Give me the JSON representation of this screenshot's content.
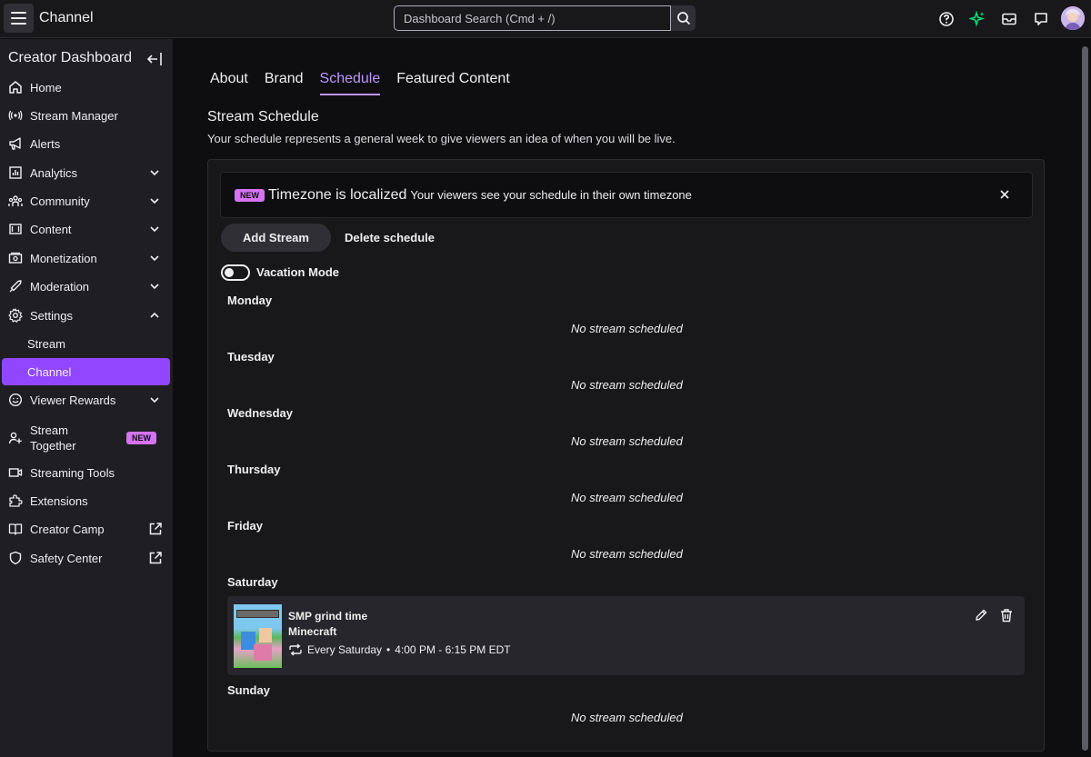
{
  "topbar": {
    "title": "Channel",
    "search_placeholder": "Dashboard Search (Cmd + /)"
  },
  "sidebar": {
    "title": "Creator Dashboard",
    "items": [
      {
        "label": "Home",
        "icon": "home-icon"
      },
      {
        "label": "Stream Manager",
        "icon": "broadcast-icon"
      },
      {
        "label": "Alerts",
        "icon": "megaphone-icon"
      },
      {
        "label": "Analytics",
        "icon": "analytics-icon"
      },
      {
        "label": "Community",
        "icon": "community-icon"
      },
      {
        "label": "Content",
        "icon": "content-icon"
      },
      {
        "label": "Monetization",
        "icon": "money-icon"
      },
      {
        "label": "Moderation",
        "icon": "sword-icon"
      },
      {
        "label": "Settings",
        "icon": "gear-icon"
      },
      {
        "label": "Stream"
      },
      {
        "label": "Channel"
      },
      {
        "label": "Viewer Rewards",
        "icon": "rewards-icon"
      },
      {
        "label": "Stream Together",
        "icon": "add-person-icon",
        "badge": "NEW"
      },
      {
        "label": "Streaming Tools",
        "icon": "camera-icon"
      },
      {
        "label": "Extensions",
        "icon": "puzzle-icon"
      },
      {
        "label": "Creator Camp",
        "icon": "book-icon"
      },
      {
        "label": "Safety Center",
        "icon": "shield-icon"
      }
    ]
  },
  "tabs": [
    "About",
    "Brand",
    "Schedule",
    "Featured Content"
  ],
  "section": {
    "title": "Stream Schedule",
    "description": "Your schedule represents a general week to give viewers an idea of when you will be live."
  },
  "notice": {
    "badge": "NEW",
    "title": "Timezone is localized",
    "text": "Your viewers see your schedule in their own timezone"
  },
  "actions": {
    "add": "Add Stream",
    "delete": "Delete schedule",
    "vacation": "Vacation Mode",
    "vacation_on": false
  },
  "schedule": {
    "empty_text": "No stream scheduled",
    "days": [
      "Monday",
      "Tuesday",
      "Wednesday",
      "Thursday",
      "Friday",
      "Saturday",
      "Sunday"
    ]
  },
  "stream": {
    "title": "SMP grind time",
    "game": "Minecraft",
    "recurrence": "Every Saturday",
    "time": "4:00 PM - 6:15 PM EDT",
    "thumbnail_text": "MINECRAFT"
  },
  "colors": {
    "accent": "#9147ff",
    "accent_text": "#bf94ff",
    "new_badge": "#d573f2",
    "sparkle": "#00e07a"
  }
}
